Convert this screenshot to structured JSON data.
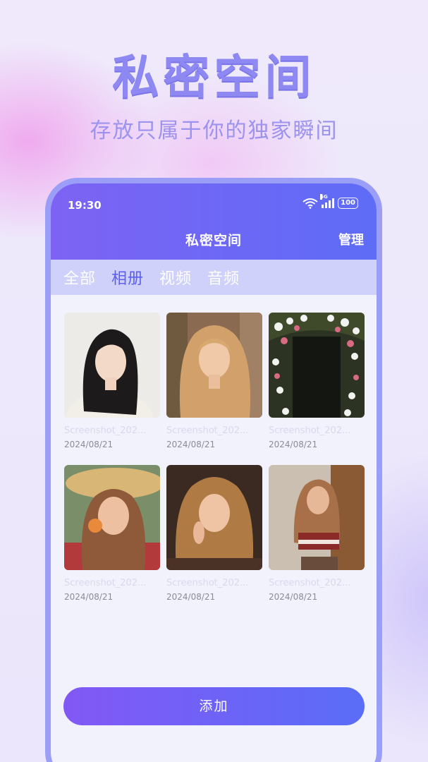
{
  "hero": {
    "title": "私密空间",
    "subtitle": "存放只属于你的独家瞬间"
  },
  "status_bar": {
    "time": "19:30",
    "network": "5G",
    "battery": "100",
    "icons": [
      "wifi-icon",
      "signal-icon",
      "battery-icon"
    ]
  },
  "nav": {
    "title": "私密空间",
    "manage": "管理"
  },
  "tabs": [
    {
      "label": "全部",
      "active": false
    },
    {
      "label": "相册",
      "active": true
    },
    {
      "label": "视频",
      "active": false
    },
    {
      "label": "音频",
      "active": false
    }
  ],
  "items": [
    {
      "name": "Screenshot_202...",
      "date": "2024/08/21"
    },
    {
      "name": "Screenshot_202...",
      "date": "2024/08/21"
    },
    {
      "name": "Screenshot_202...",
      "date": "2024/08/21"
    },
    {
      "name": "Screenshot_202...",
      "date": "2024/08/21"
    },
    {
      "name": "Screenshot_202...",
      "date": "2024/08/21"
    },
    {
      "name": "Screenshot_202...",
      "date": "2024/08/21"
    }
  ],
  "add_button": "添加",
  "colors": {
    "accent": "#5b5ef0",
    "header_start": "#7d63f4",
    "header_end": "#5e6cf6",
    "tab_bar": "#d0d1fa"
  }
}
